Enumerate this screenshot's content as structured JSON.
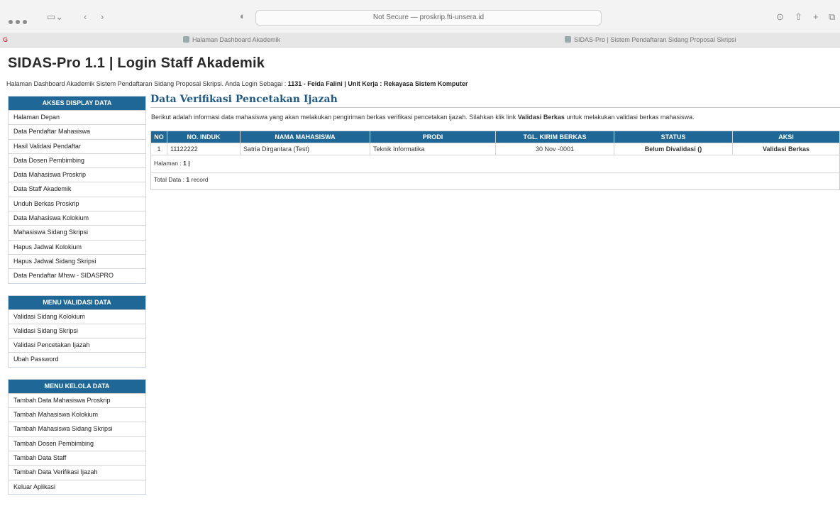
{
  "browser": {
    "url_text": "Not Secure — proskrip.fti-unsera.id",
    "tabs": [
      "Halaman Dashboard Akademik",
      "SIDAS-Pro | Sistem Pendaftaran Sidang Proposal Skripsi"
    ]
  },
  "header": {
    "title": "SIDAS-Pro 1.1 | Login Staff Akademik",
    "intro_prefix": "Halaman Dashboard Akademik Sistem Pendaftaran Sidang Proposal Skripsi. Anda Login Sebagai :",
    "intro_user": "1131 - Feida Falini | Unit Kerja : Rekayasa Sistem Komputer"
  },
  "sidebar": {
    "menus": [
      {
        "title": "AKSES DISPLAY DATA",
        "items": [
          "Halaman Depan",
          "Data Pendaftar Mahasiswa",
          "Hasil Validasi Pendaftar",
          "Data Dosen Pembimbing",
          "Data Mahasiswa Proskrip",
          "Data Staff Akademik",
          "Unduh Berkas Proskrip",
          "Data Mahasiswa Kolokium",
          "Mahasiswa Sidang Skripsi",
          "Hapus Jadwal Kolokium",
          "Hapus Jadwal Sidang Skripsi",
          "Data Pendaftar Mhsw - SIDASPRO"
        ]
      },
      {
        "title": "MENU VALIDASI DATA",
        "items": [
          "Validasi Sidang Kolokium",
          "Validasi Sidang Skripsi",
          "Validasi Pencetakan Ijazah",
          "Ubah Password"
        ]
      },
      {
        "title": "MENU KELOLA DATA",
        "items": [
          "Tambah Data Mahasiswa Proskrip",
          "Tambah Mahasiswa Kolokium",
          "Tambah Mahasiswa Sidang Skripsi",
          "Tambah Dosen Pembimbing",
          "Tambah Data Staff",
          "Tambah Data Verifikasi Ijazah",
          "Keluar Aplikasi"
        ]
      }
    ]
  },
  "main": {
    "heading": "Data Verifikasi Pencetakan Ijazah",
    "desc_before": "Berikut adalah informasi data mahasiswa yang akan melakukan pengiriman berkas verifikasi pencetakan ijazah. Silahkan klik link",
    "desc_link": "Validasi Berkas",
    "desc_after": "untuk melakukan validasi berkas mahasiswa.",
    "table": {
      "headers": [
        "NO",
        "NO. INDUK",
        "NAMA MAHASISWA",
        "PRODI",
        "TGL. KIRIM BERKAS",
        "STATUS",
        "AKSI"
      ],
      "rows": [
        [
          "1",
          "11122222",
          "Satria Dirgantara (Test)",
          "Teknik Informatika",
          "30 Nov -0001",
          "Belum Divalidasi ()",
          "Validasi Berkas"
        ]
      ]
    },
    "pagination_label": "Halaman :",
    "pagination_value": "1 |",
    "total_label": "Total Data :",
    "total_value": "1",
    "total_unit": "record"
  },
  "colors": {
    "menu_header": "#1f6796",
    "heading": "#1f5a86"
  }
}
